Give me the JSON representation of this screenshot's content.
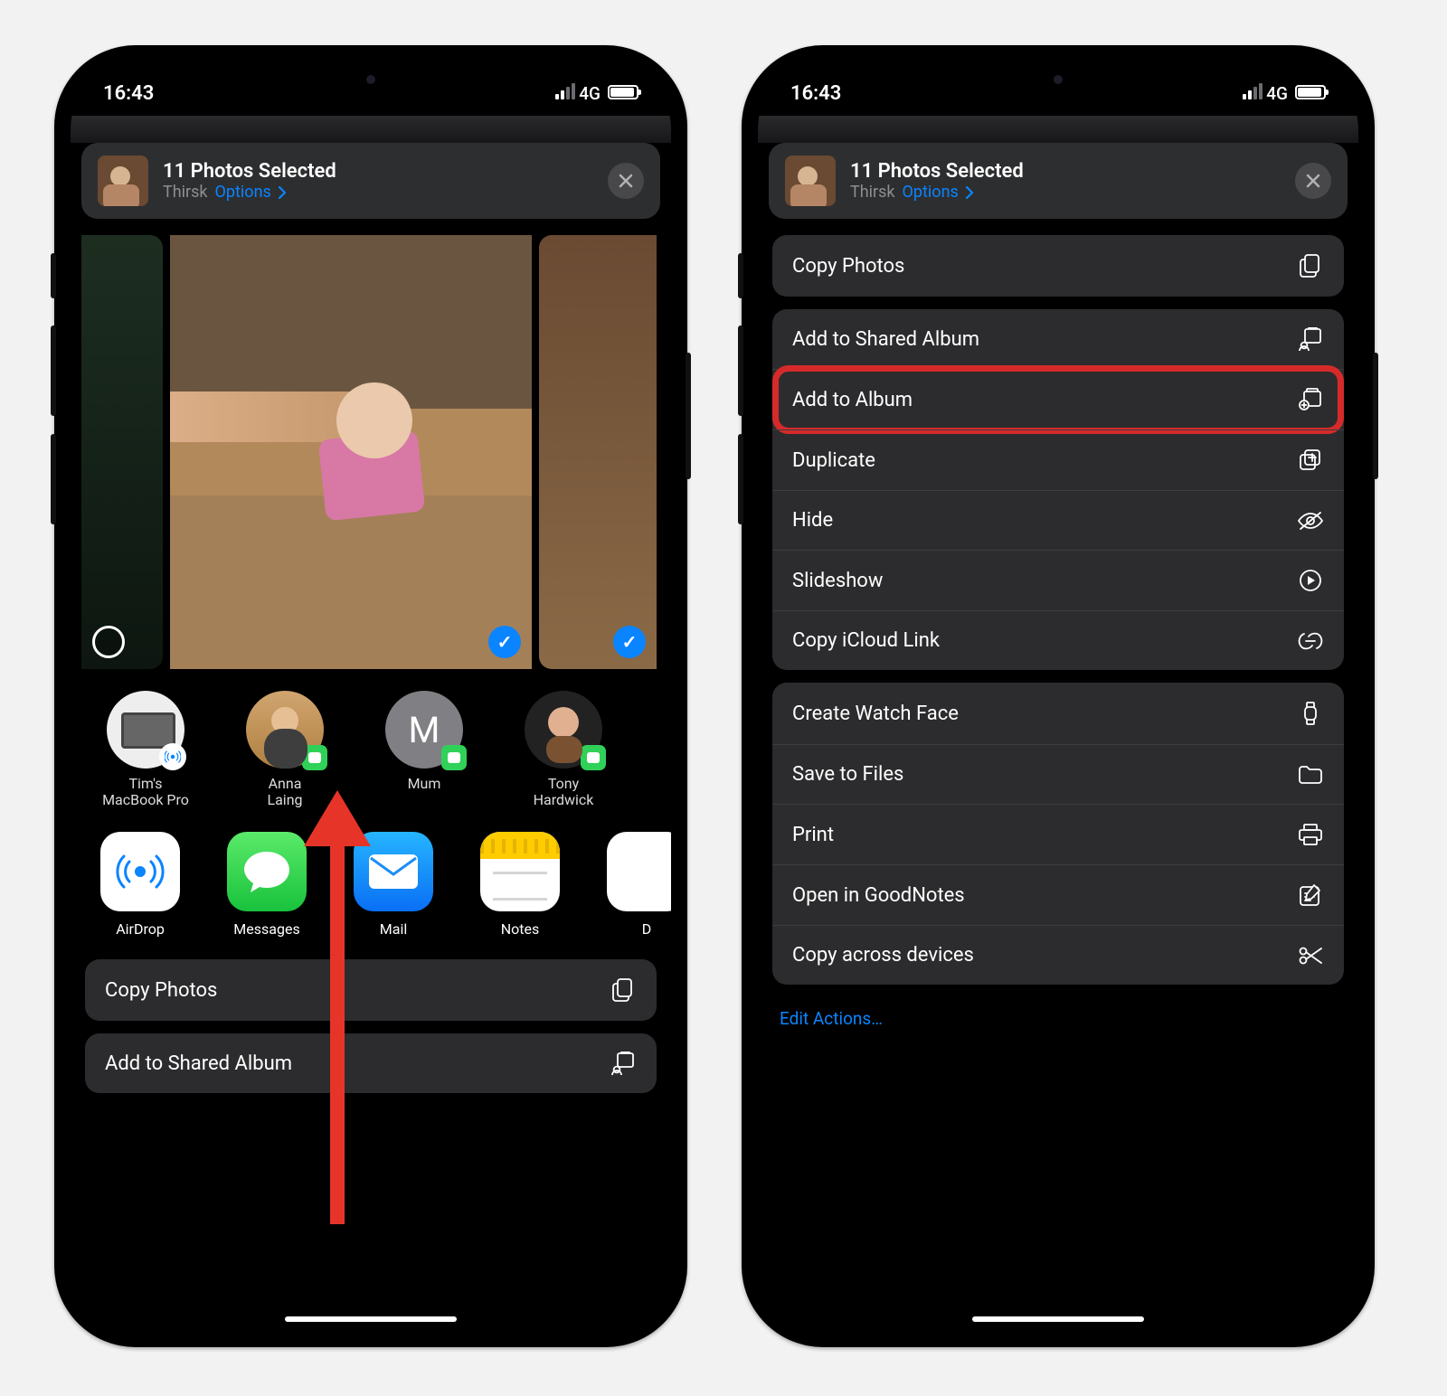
{
  "status": {
    "time": "16:43",
    "cellLabel": "4G"
  },
  "sheet": {
    "title": "11 Photos Selected",
    "subtitle": "Thirsk",
    "options": "Options"
  },
  "contacts": [
    {
      "name": "Tim's\nMacBook Pro",
      "avatar": "macbook",
      "badge": "airdrop"
    },
    {
      "name": "Anna\nLaing",
      "avatar": "anna",
      "badge": "messages"
    },
    {
      "name": "Mum",
      "avatar": "M",
      "badge": "messages"
    },
    {
      "name": "Tony\nHardwick",
      "avatar": "tony",
      "badge": "messages"
    }
  ],
  "apps": [
    {
      "name": "AirDrop",
      "icon": "airdrop"
    },
    {
      "name": "Messages",
      "icon": "messages"
    },
    {
      "name": "Mail",
      "icon": "mail"
    },
    {
      "name": "Notes",
      "icon": "notes"
    },
    {
      "name": "D",
      "icon": "drive"
    }
  ],
  "phone1Actions": [
    {
      "label": "Copy Photos",
      "icon": "copy"
    },
    {
      "label": "Add to Shared Album",
      "icon": "shared-album"
    }
  ],
  "phone2Groups": [
    {
      "rows": [
        {
          "label": "Copy Photos",
          "icon": "copy"
        }
      ]
    },
    {
      "rows": [
        {
          "label": "Add to Shared Album",
          "icon": "shared-album"
        },
        {
          "label": "Add to Album",
          "icon": "add-album",
          "highlight": true
        },
        {
          "label": "Duplicate",
          "icon": "duplicate"
        },
        {
          "label": "Hide",
          "icon": "hide"
        },
        {
          "label": "Slideshow",
          "icon": "play"
        },
        {
          "label": "Copy iCloud Link",
          "icon": "link"
        }
      ]
    },
    {
      "rows": [
        {
          "label": "Create Watch Face",
          "icon": "watch"
        },
        {
          "label": "Save to Files",
          "icon": "folder"
        },
        {
          "label": "Print",
          "icon": "print"
        },
        {
          "label": "Open in GoodNotes",
          "icon": "note"
        },
        {
          "label": "Copy across devices",
          "icon": "scissors"
        }
      ]
    }
  ],
  "editActions": "Edit Actions…"
}
